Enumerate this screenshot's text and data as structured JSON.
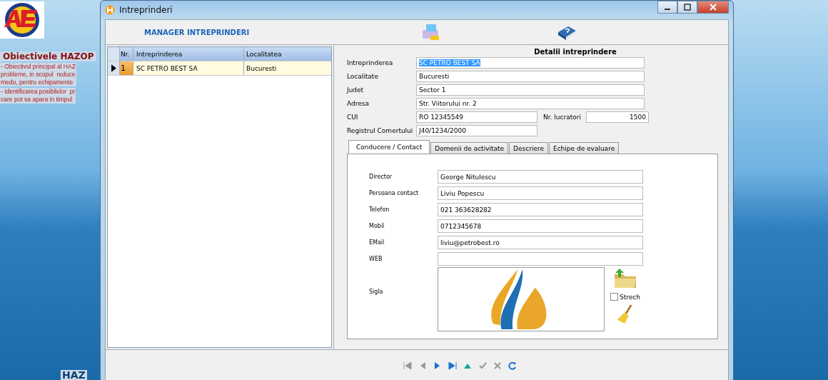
{
  "desktop": {
    "heading": "Obiectivele HAZOP",
    "paragraphs": [
      "- Obiectivul principal al HAZ\nprobleme, in scopul  reduce\nmedu, pentru echipamente",
      "- Identificarea posibilelor  pr\ncare pot sa apara in timpul"
    ],
    "footer": "HAZ"
  },
  "window": {
    "title": "Intreprinderi"
  },
  "toolbar": {
    "title": "MANAGER INTREPRINDERI"
  },
  "grid": {
    "columns": [
      "Nr.",
      "Intreprinderea",
      "Localitatea"
    ],
    "rows": [
      {
        "nr": "1",
        "name": "SC PETRO BEST SA",
        "city": "Bucuresti",
        "selected": true
      }
    ]
  },
  "details": {
    "title": "Detalii intreprindere",
    "fields": [
      {
        "label": "Intreprinderea",
        "value": "SC PETRO BEST SA",
        "selected": true
      },
      {
        "label": "Localitate",
        "value": "Bucuresti",
        "selected": false
      },
      {
        "label": "Judet",
        "value": "Sector 1",
        "selected": false
      },
      {
        "label": "Adresa",
        "value": "Str. Viitorului nr. 2",
        "selected": false
      }
    ],
    "cui": {
      "label": "CUI",
      "value": "RO 12345549"
    },
    "employees": {
      "label": "Nr. lucratori",
      "value": "1500"
    },
    "registry": {
      "label": "Registrul Comertului",
      "value": "J40/1234/2000"
    }
  },
  "tabs": [
    {
      "label": "Conducere / Contact",
      "selected": true
    },
    {
      "label": "Domenii de activitate",
      "selected": false
    },
    {
      "label": "Descriere",
      "selected": false
    },
    {
      "label": "Echipe de evaluare",
      "selected": false
    }
  ],
  "contact": [
    {
      "label": "Director",
      "value": "George Nitulescu"
    },
    {
      "label": "Persoana contact",
      "value": "Liviu Popescu"
    },
    {
      "label": "Telefon",
      "value": "021 363628282"
    },
    {
      "label": "Mobil",
      "value": "0712345678"
    },
    {
      "label": "EMail",
      "value": "liviu@petrobest.ro"
    },
    {
      "label": "WEB"
    }
  ],
  "logo": {
    "label": "Sigla",
    "stretch": {
      "label": "Strech",
      "checked": false
    }
  },
  "navigator": [
    {
      "kind": "first",
      "disabled": true
    },
    {
      "kind": "prior",
      "disabled": true
    },
    {
      "kind": "next",
      "disabled": false
    },
    {
      "kind": "last",
      "disabled": false
    },
    {
      "kind": "insert",
      "disabled": false
    },
    {
      "kind": "post",
      "disabled": true
    },
    {
      "kind": "cancel",
      "disabled": true
    },
    {
      "kind": "refresh",
      "disabled": false
    }
  ]
}
